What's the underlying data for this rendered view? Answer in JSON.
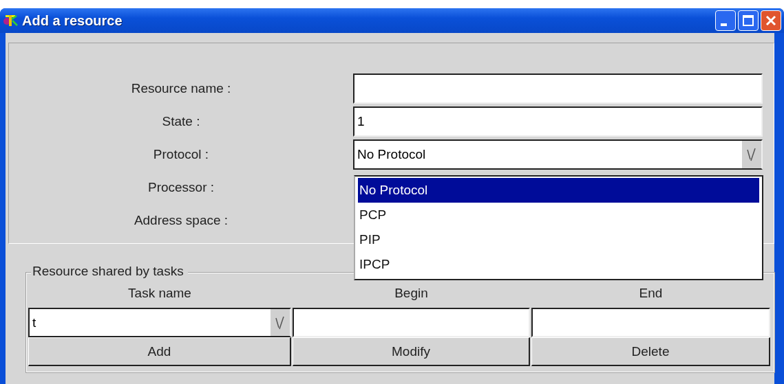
{
  "window": {
    "title": "Add a resource"
  },
  "form": {
    "fields": [
      {
        "label": "Resource name :",
        "kind": "text"
      },
      {
        "label": "State :",
        "kind": "text",
        "value": "1"
      },
      {
        "label": "Protocol :",
        "kind": "combo",
        "value": "No Protocol"
      },
      {
        "label": "Processor :"
      },
      {
        "label": "Address space :"
      }
    ]
  },
  "dropdown": {
    "options": [
      {
        "label": "No Protocol",
        "selected": true
      },
      {
        "label": "PCP",
        "selected": false
      },
      {
        "label": "PIP",
        "selected": false
      },
      {
        "label": "IPCP",
        "selected": false
      }
    ]
  },
  "tasks": {
    "title": "Resource shared by tasks",
    "columns": [
      "Task name",
      "Begin",
      "End"
    ],
    "task_name": "t",
    "buttons": [
      "Add",
      "Modify",
      "Delete"
    ]
  }
}
